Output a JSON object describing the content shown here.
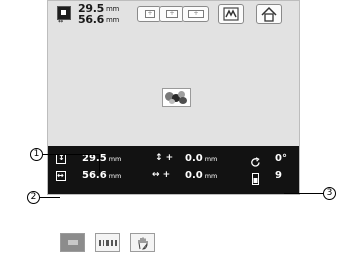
{
  "embroidery_size": {
    "height_value": "29.5",
    "height_unit": "mm",
    "width_value": "56.6",
    "width_unit": "mm"
  },
  "info_bar": {
    "height_value": "29.5",
    "height_unit": "mm",
    "width_value": "56.6",
    "width_unit": "mm",
    "vertical_offset_value": "0.0",
    "vertical_offset_unit": "mm",
    "horizontal_offset_value": "0.0",
    "horizontal_offset_unit": "mm",
    "angle_value": "0°",
    "color_changes_value": "9"
  },
  "callouts": [
    "1",
    "2",
    "3"
  ],
  "icons": {
    "size_icon": "embroidery-size-icon",
    "frame_icons": [
      "small-frame-icon",
      "medium-frame-icon",
      "large-frame-icon"
    ],
    "edit_icon": "edit-icon",
    "home_icon": "home-icon",
    "vertical_icon": "vertical-size-icon",
    "horizontal_icon": "horizontal-size-icon",
    "vertical_offset_icon": "vertical-offset-icon",
    "horizontal_offset_icon": "horizontal-offset-icon",
    "rotate_icon": "rotate-icon",
    "thread_spool_icon": "thread-spool-icon",
    "bottom_buttons": [
      "thread-color-icon",
      "stitch-bar-icon",
      "hand-icon"
    ]
  }
}
